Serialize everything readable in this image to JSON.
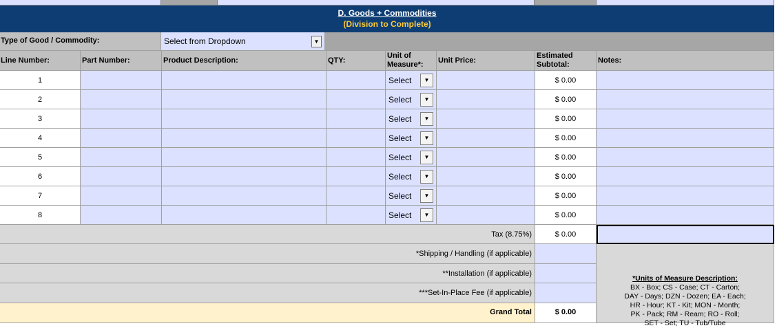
{
  "section": {
    "title": "D. Goods + Commodities",
    "subtitle": "(Division to Complete)"
  },
  "type_row": {
    "label": "Type of Good / Commodity:",
    "select_value": "Select from Dropdown"
  },
  "columns": {
    "line": "Line Number:",
    "part": "Part Number:",
    "desc": "Product Description:",
    "qty": "QTY:",
    "uom": "Unit of Measure*:",
    "price": "Unit Price:",
    "subtotal": "Estimated Subtotal:",
    "notes": "Notes:"
  },
  "rows": [
    {
      "line": "1",
      "part": "",
      "desc": "",
      "qty": "",
      "uom": "Select",
      "price": "",
      "subtotal": "$ 0.00",
      "notes": ""
    },
    {
      "line": "2",
      "part": "",
      "desc": "",
      "qty": "",
      "uom": "Select",
      "price": "",
      "subtotal": "$ 0.00",
      "notes": ""
    },
    {
      "line": "3",
      "part": "",
      "desc": "",
      "qty": "",
      "uom": "Select",
      "price": "",
      "subtotal": "$ 0.00",
      "notes": ""
    },
    {
      "line": "4",
      "part": "",
      "desc": "",
      "qty": "",
      "uom": "Select",
      "price": "",
      "subtotal": "$ 0.00",
      "notes": ""
    },
    {
      "line": "5",
      "part": "",
      "desc": "",
      "qty": "",
      "uom": "Select",
      "price": "",
      "subtotal": "$ 0.00",
      "notes": ""
    },
    {
      "line": "6",
      "part": "",
      "desc": "",
      "qty": "",
      "uom": "Select",
      "price": "",
      "subtotal": "$ 0.00",
      "notes": ""
    },
    {
      "line": "7",
      "part": "",
      "desc": "",
      "qty": "",
      "uom": "Select",
      "price": "",
      "subtotal": "$ 0.00",
      "notes": ""
    },
    {
      "line": "8",
      "part": "",
      "desc": "",
      "qty": "",
      "uom": "Select",
      "price": "",
      "subtotal": "$ 0.00",
      "notes": ""
    }
  ],
  "totals": {
    "tax_label": "Tax (8.75%)",
    "tax_value": "$ 0.00",
    "shipping_label": "*Shipping / Handling (if applicable)",
    "shipping_value": "",
    "installation_label": "**Installation (if applicable)",
    "installation_value": "",
    "setinplace_label": "***Set-In-Place Fee (if applicable)",
    "setinplace_value": "",
    "grand_label": "Grand Total",
    "grand_value": "$ 0.00"
  },
  "uom_legend": {
    "title": "*Units of Measure Description:",
    "lines": [
      "BX - Box; CS - Case; CT - Carton;",
      "DAY - Days; DZN - Dozen; EA - Each;",
      "HR - Hour; KT - Kit; MON - Month;",
      "PK - Pack; RM - Ream; RO - Roll;",
      "SET - Set; TU - Tub/Tube"
    ]
  },
  "icons": {
    "dropdown_arrow": "dropdown-arrow-icon"
  },
  "colors": {
    "header_bg": "#0e3d74",
    "header_subtitle": "#ffcc33",
    "input_fill": "#dbe1ff",
    "label_fill": "#c0c0c0",
    "grand_total_fill": "#fff2cc"
  }
}
